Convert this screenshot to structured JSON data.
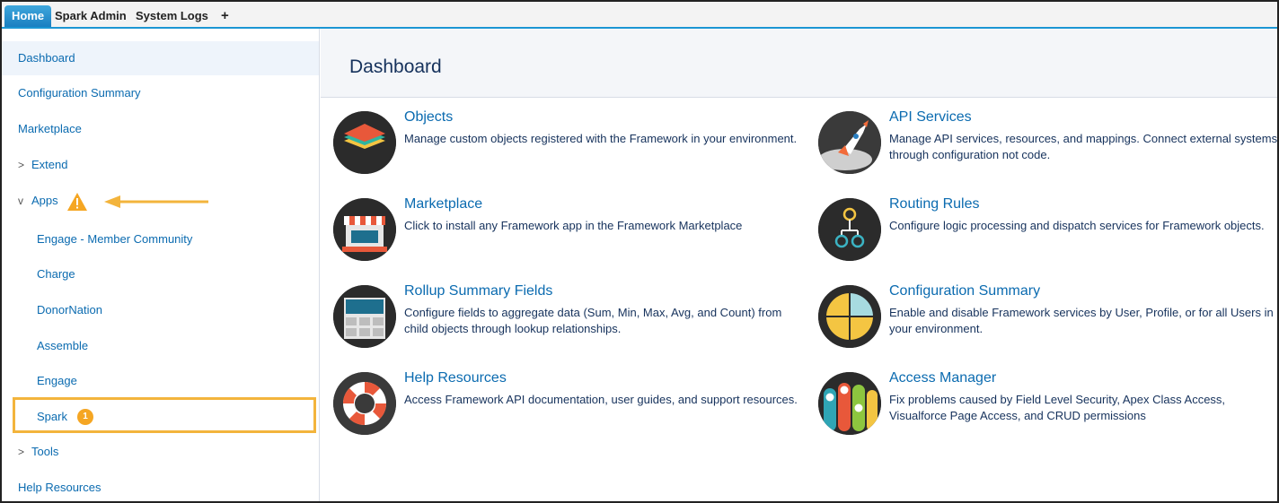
{
  "tabs": [
    {
      "label": "Home"
    },
    {
      "label": "Spark Admin"
    },
    {
      "label": "System Logs"
    },
    {
      "label": "+"
    }
  ],
  "sidebar": {
    "items": [
      {
        "label": "Dashboard"
      },
      {
        "label": "Configuration Summary"
      },
      {
        "label": "Marketplace"
      },
      {
        "label": "Extend",
        "chevron": ">"
      },
      {
        "label": "Apps",
        "chevron": "v"
      },
      {
        "label": "Engage - Member Community"
      },
      {
        "label": "Charge"
      },
      {
        "label": "DonorNation"
      },
      {
        "label": "Assemble"
      },
      {
        "label": "Engage"
      },
      {
        "label": "Spark",
        "badge": "1"
      },
      {
        "label": "Tools",
        "chevron": ">"
      },
      {
        "label": "Help Resources"
      }
    ]
  },
  "main": {
    "title": "Dashboard",
    "cards": [
      {
        "title": "Objects",
        "desc": "Manage custom objects registered with the Framework in your environment."
      },
      {
        "title": "API Services",
        "desc": "Manage API services, resources, and mappings. Connect external systems through configuration not code."
      },
      {
        "title": "Marketplace",
        "desc": "Click to install any Framework app in the Framework Marketplace"
      },
      {
        "title": "Routing Rules",
        "desc": "Configure logic processing and dispatch services for Framework objects."
      },
      {
        "title": "Rollup Summary Fields",
        "desc": "Configure fields to aggregate data (Sum, Min, Max, Avg, and Count) from child objects through lookup relationships."
      },
      {
        "title": "Configuration Summary",
        "desc": "Enable and disable Framework services by User, Profile, or for all Users in your environment."
      },
      {
        "title": "Help Resources",
        "desc": "Access Framework API documentation, user guides, and support resources."
      },
      {
        "title": "Access Manager",
        "desc": "Fix problems caused by Field Level Security, Apex Class Access, Visualforce Page Access, and CRUD permissions"
      }
    ]
  },
  "colors": {
    "accent": "#0b6bb0",
    "highlight": "#f3b43c",
    "badge": "#f5a623"
  }
}
